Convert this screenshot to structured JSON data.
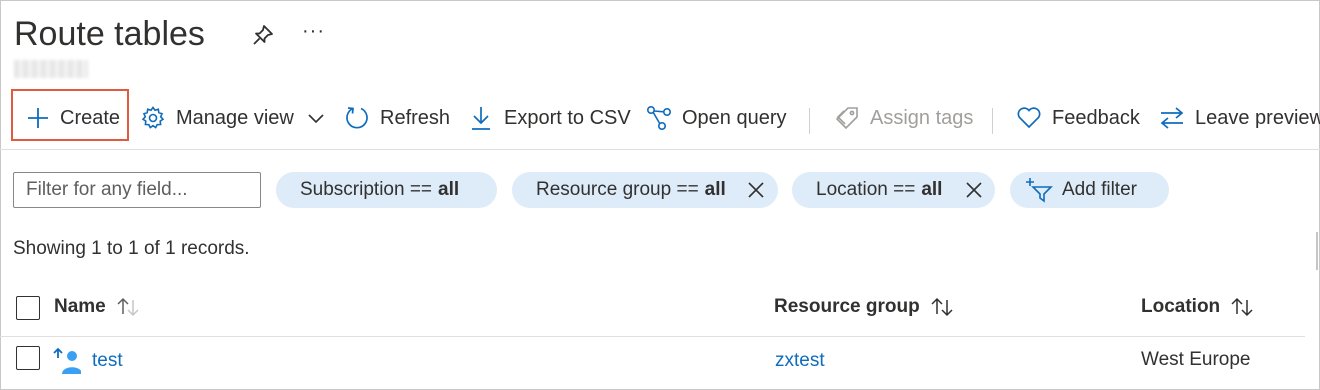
{
  "header": {
    "title": "Route tables",
    "more_label": "···"
  },
  "toolbar": {
    "create": "Create",
    "manage_view": "Manage view",
    "refresh": "Refresh",
    "export_csv": "Export to CSV",
    "open_query": "Open query",
    "assign_tags": "Assign tags",
    "feedback": "Feedback",
    "leave_preview": "Leave preview"
  },
  "filters": {
    "placeholder": "Filter for any field...",
    "pills": [
      {
        "label": "Subscription ==",
        "value": "all",
        "removable": false
      },
      {
        "label": "Resource group ==",
        "value": "all",
        "removable": true
      },
      {
        "label": "Location ==",
        "value": "all",
        "removable": true
      }
    ],
    "add_filter": "Add filter"
  },
  "records_text": "Showing 1 to 1 of 1 records.",
  "table": {
    "columns": [
      "Name",
      "Resource group",
      "Location"
    ],
    "rows": [
      {
        "name": "test",
        "resource_group": "zxtest",
        "location": "West Europe"
      }
    ]
  },
  "colors": {
    "accent": "#0f6cbd",
    "create_highlight": "#e05a3f",
    "pill_bg": "#deecf9"
  },
  "icons": {
    "pin": "pin-icon",
    "create": "plus-icon",
    "manage_view": "gear-icon",
    "refresh": "refresh-icon",
    "export": "download-icon",
    "open_query": "query-icon",
    "assign_tags": "tag-icon",
    "feedback": "heart-icon",
    "leave_preview": "swap-arrows-icon",
    "add_filter": "filter-add-icon",
    "route_table": "route-table-icon"
  }
}
